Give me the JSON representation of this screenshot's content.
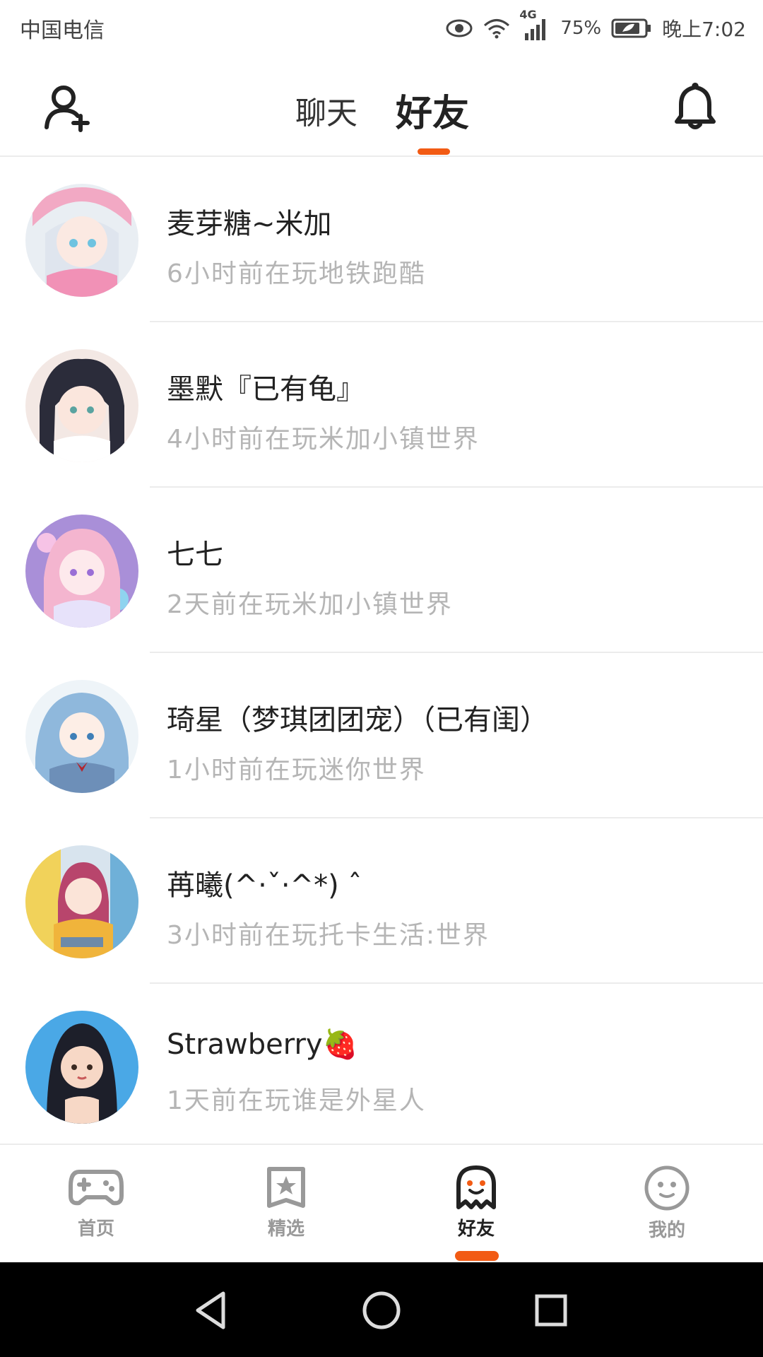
{
  "status_bar": {
    "carrier": "中国电信",
    "network": "4G",
    "battery": "75%",
    "time": "晚上7:02"
  },
  "header": {
    "tabs": [
      {
        "label": "聊天",
        "active": false
      },
      {
        "label": "好友",
        "active": true
      }
    ],
    "left_icon": "add-friend-icon",
    "right_icon": "bell-icon",
    "accent_color": "#f25b14"
  },
  "friends": [
    {
      "name": "麦芽糖~米加",
      "status": "6小时前在玩地铁跑酷"
    },
    {
      "name": "墨默『已有龟』",
      "status": "4小时前在玩米加小镇世界"
    },
    {
      "name": "七七",
      "status": "2天前在玩米加小镇世界"
    },
    {
      "name": "琦星（梦琪团团宠）（已有闺）",
      "status": "1小时前在玩迷你世界"
    },
    {
      "name": "苒曦(^·ˇ·^*) ˆ",
      "status": "3小时前在玩托卡生活:世界"
    },
    {
      "name": "Strawberry🍓",
      "status": "1天前在玩谁是外星人"
    }
  ],
  "bottom_nav": [
    {
      "label": "首页",
      "icon": "gamepad-icon",
      "active": false
    },
    {
      "label": "精选",
      "icon": "star-badge-icon",
      "active": false
    },
    {
      "label": "好友",
      "icon": "ghost-icon",
      "active": true
    },
    {
      "label": "我的",
      "icon": "face-icon",
      "active": false
    }
  ]
}
